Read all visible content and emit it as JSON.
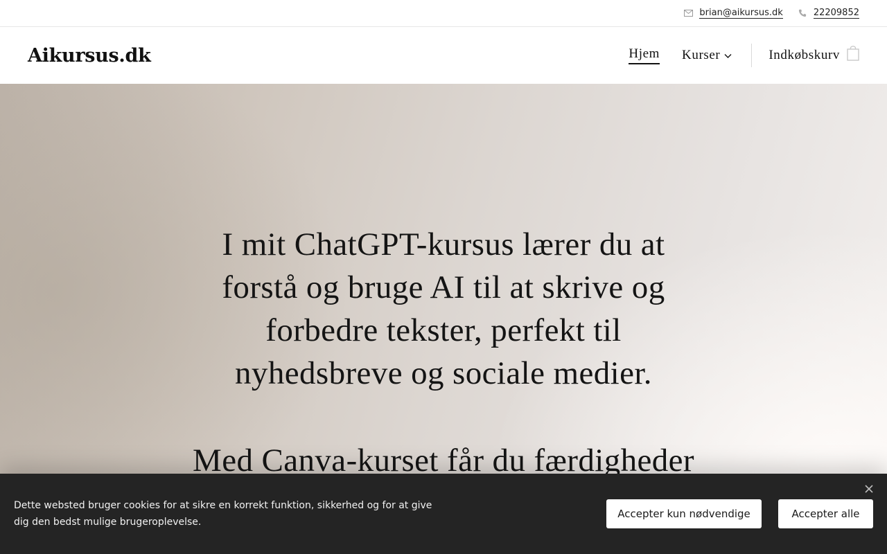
{
  "topbar": {
    "email": "brian@aikursus.dk",
    "email_icon": "mail-icon",
    "phone": "22209852",
    "phone_icon": "phone-icon"
  },
  "header": {
    "logo": "Aikursus.dk",
    "nav": {
      "home": "Hjem",
      "courses": "Kurser",
      "cart": "Indkøbskurv"
    },
    "icons": {
      "courses_dropdown": "chevron-down-icon",
      "cart": "shopping-bag-icon"
    }
  },
  "hero": {
    "paragraph1": "I mit ChatGPT-kursus lærer du at forstå og bruge AI til at skrive og forbedre tekster, perfekt til nyhedsbreve og sociale medier.",
    "paragraph2": "Med Canva-kurset får du færdigheder"
  },
  "cookie_banner": {
    "text": "Dette websted bruger cookies for at sikre en korrekt funktion, sikkerhed og for at give dig den bedst mulige brugeroplevelse.",
    "accept_necessary": "Accepter kun nødvendige",
    "accept_all": "Accepter alle",
    "close_icon": "close-icon"
  },
  "colors": {
    "text": "#111111",
    "banner_bg": "#242424",
    "button_bg": "#ffffff"
  }
}
